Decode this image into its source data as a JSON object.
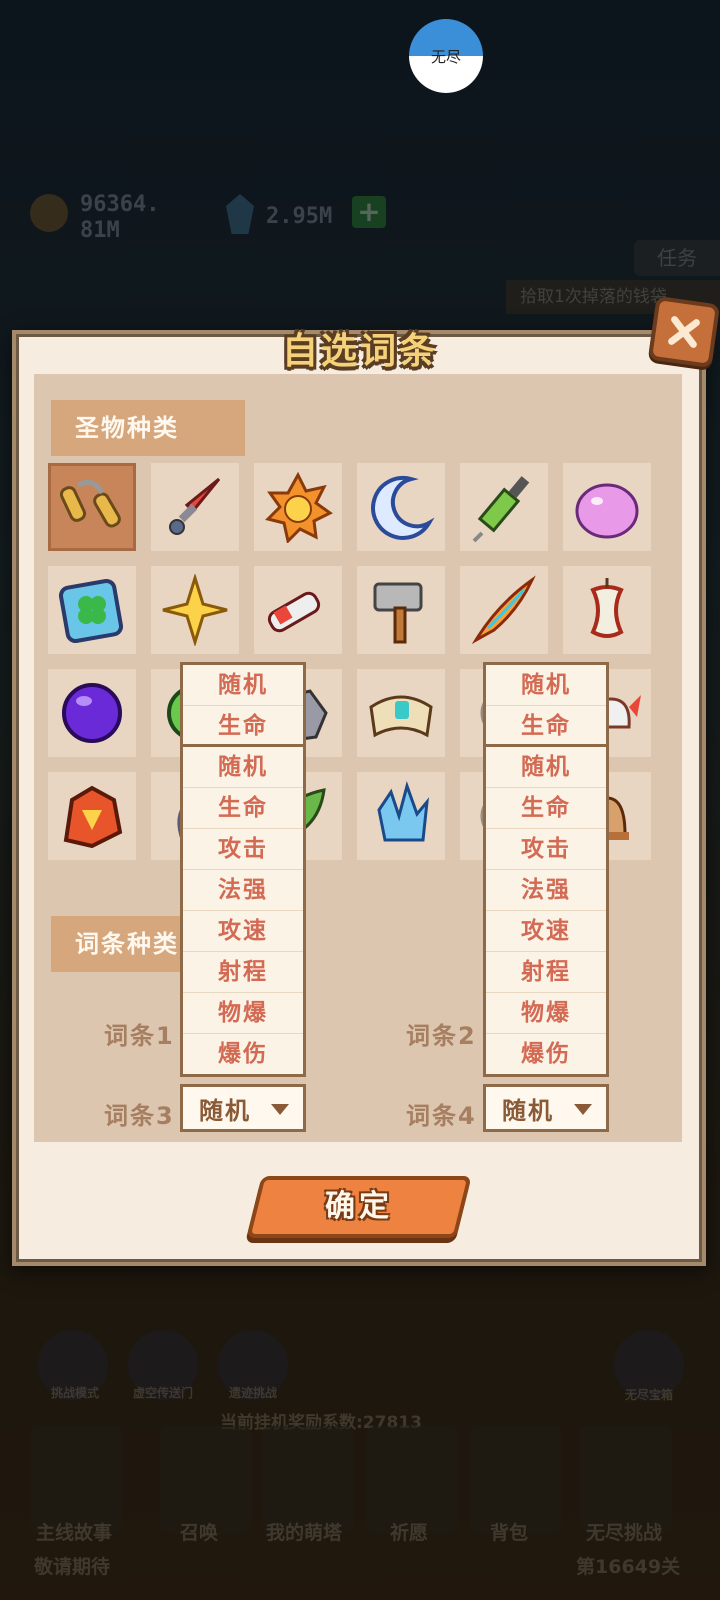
{
  "top": {
    "mode_badge": "无尽"
  },
  "background": {
    "coins": "96364.\n81M",
    "gems": "2.95M",
    "task_button": "任务",
    "quest_text": "拾取1次掉落的钱袋",
    "reward_text": "当前挂机奖励系数:27813",
    "nav": [
      "主线故事",
      "召唤",
      "我的萌塔",
      "祈愿",
      "背包",
      "无尽挑战"
    ],
    "nav_sub": [
      "敬请期待",
      "第16649关"
    ],
    "side_buttons": [
      "挑战模式",
      "虚空传送门",
      "遗迹挑战",
      "无尽宝箱"
    ]
  },
  "modal": {
    "title": "自选词条",
    "relic_section_title": "圣物种类",
    "affix_section_title": "词条种类",
    "relic_icons": [
      "nunchaku-icon",
      "red-dagger-icon",
      "sun-icon",
      "crescent-moon-icon",
      "syringe-icon",
      "pink-slime-icon",
      "clover-card-icon",
      "gold-shuriken-icon",
      "battery-icon",
      "hammer-icon",
      "flame-feather-icon",
      "apple-core-icon",
      "purple-orb-icon",
      "green-orb-icon",
      "rock-icon",
      "spellbook-icon",
      "white-item-icon",
      "winged-helmet-icon",
      "dragon-crest-icon",
      "white-vase-icon",
      "leaf-icon",
      "blue-crystal-icon",
      "white-item-icon",
      "bell-icon"
    ],
    "selected_relic_index": 0,
    "affix_rows": [
      {
        "label": "词条1"
      },
      {
        "label": "词条2"
      },
      {
        "label": "词条3",
        "value": "随机"
      },
      {
        "label": "词条4",
        "value": "随机"
      }
    ],
    "dropdown_options": [
      "随机",
      "生命",
      "攻击",
      "法强",
      "攻速",
      "射程",
      "物爆",
      "爆伤"
    ],
    "dropdown_partial": [
      "随机",
      "生命"
    ],
    "confirm_label": "确定"
  }
}
